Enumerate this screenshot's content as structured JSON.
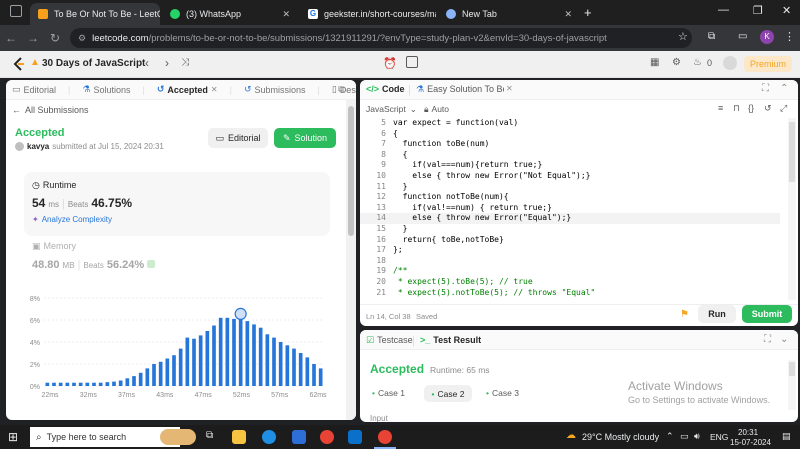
{
  "browser": {
    "tabs": [
      {
        "title": "To Be Or Not To Be - LeetCode",
        "color": "#f89f1b"
      },
      {
        "title": "(3) WhatsApp",
        "color": "#25d366"
      },
      {
        "title": "geekster.in/short-courses/mast",
        "color": "#1a73e8"
      },
      {
        "title": "New Tab",
        "color": "#5f6368"
      }
    ],
    "url_host": "leetcode.com",
    "url_path": "/problems/to-be-or-not-to-be/submissions/1321911291/?envType=study-plan-v2&envId=30-days-of-javascript",
    "profile_initial": "K"
  },
  "lc": {
    "study_plan": "30 Days of JavaScript",
    "premium": "Premium",
    "streak": "0"
  },
  "left": {
    "tabs": [
      "Editorial",
      "Solutions",
      "Accepted",
      "Submissions",
      "Description"
    ],
    "back_link": "All Submissions",
    "status": "Accepted",
    "user": "kavya",
    "submitted_at": "submitted at Jul 15, 2024 20:31",
    "editorial_btn": "Editorial",
    "solution_btn": "Solution",
    "runtime_label": "Runtime",
    "runtime_value": "54",
    "runtime_unit": "ms",
    "beats_label": "Beats",
    "runtime_beats": "46.75%",
    "analyze": "Analyze Complexity",
    "memory_label": "Memory",
    "memory_value": "48.80",
    "memory_unit": "MB",
    "memory_beats": "56.24%"
  },
  "chart_data": {
    "type": "bar",
    "y_ticks": [
      "8%",
      "6%",
      "4%",
      "2%",
      "0%"
    ],
    "x_ticks": [
      "22ms",
      "32ms",
      "37ms",
      "43ms",
      "47ms",
      "52ms",
      "57ms",
      "62ms"
    ],
    "ylim": [
      0,
      8
    ],
    "values": [
      0.3,
      0.3,
      0.3,
      0.3,
      0.3,
      0.3,
      0.3,
      0.3,
      0.3,
      0.35,
      0.4,
      0.5,
      0.7,
      0.9,
      1.2,
      1.6,
      2.0,
      2.2,
      2.5,
      2.8,
      3.4,
      4.4,
      4.3,
      4.6,
      5.0,
      5.5,
      6.2,
      6.2,
      6.1,
      6.1,
      5.9,
      5.6,
      5.3,
      4.7,
      4.4,
      4.0,
      3.7,
      3.4,
      3.0,
      2.6,
      2.0,
      1.6
    ],
    "highlight_index": 29,
    "bar_color": "#2676d9",
    "grid": true
  },
  "editor": {
    "tabs": [
      "Code",
      "Easy Solution To Be"
    ],
    "language": "JavaScript",
    "mode": "Auto",
    "lines": [
      {
        "n": "5",
        "t": "var expect = function(val)"
      },
      {
        "n": "6",
        "t": "{"
      },
      {
        "n": "7",
        "t": "  function toBe(num)"
      },
      {
        "n": "8",
        "t": "  {"
      },
      {
        "n": "9",
        "t": "    if(val===num){return true;}"
      },
      {
        "n": "10",
        "t": "    else { throw new Error(\"Not Equal\");}"
      },
      {
        "n": "11",
        "t": "  }"
      },
      {
        "n": "12",
        "t": "  function notToBe(num){"
      },
      {
        "n": "13",
        "t": "    if(val!==num) { return true;}"
      },
      {
        "n": "14",
        "t": "    else { throw new Error(\"Equal\");}"
      },
      {
        "n": "15",
        "t": "  }"
      },
      {
        "n": "16",
        "t": "  return{ toBe,notToBe}"
      },
      {
        "n": "17",
        "t": "};"
      },
      {
        "n": "18",
        "t": ""
      },
      {
        "n": "19",
        "t": "/**"
      },
      {
        "n": "20",
        "t": " * expect(5).toBe(5); // true"
      },
      {
        "n": "21",
        "t": " * expect(5).notToBe(5); // throws \"Equal\""
      }
    ],
    "status": "Ln 14, Col 38",
    "saved": "Saved",
    "run": "Run",
    "submit": "Submit"
  },
  "result": {
    "tabs": [
      "Testcase",
      "Test Result"
    ],
    "status": "Accepted",
    "runtime": "Runtime: 65 ms",
    "cases": [
      "Case 1",
      "Case 2",
      "Case 3"
    ],
    "input_label": "Input"
  },
  "windows": {
    "activate_title": "Activate Windows",
    "activate_sub": "Go to Settings to activate Windows.",
    "search": "Type here to search",
    "weather": "29°C  Mostly cloudy",
    "lang": "ENG",
    "time": "20:31",
    "date": "15-07-2024"
  }
}
